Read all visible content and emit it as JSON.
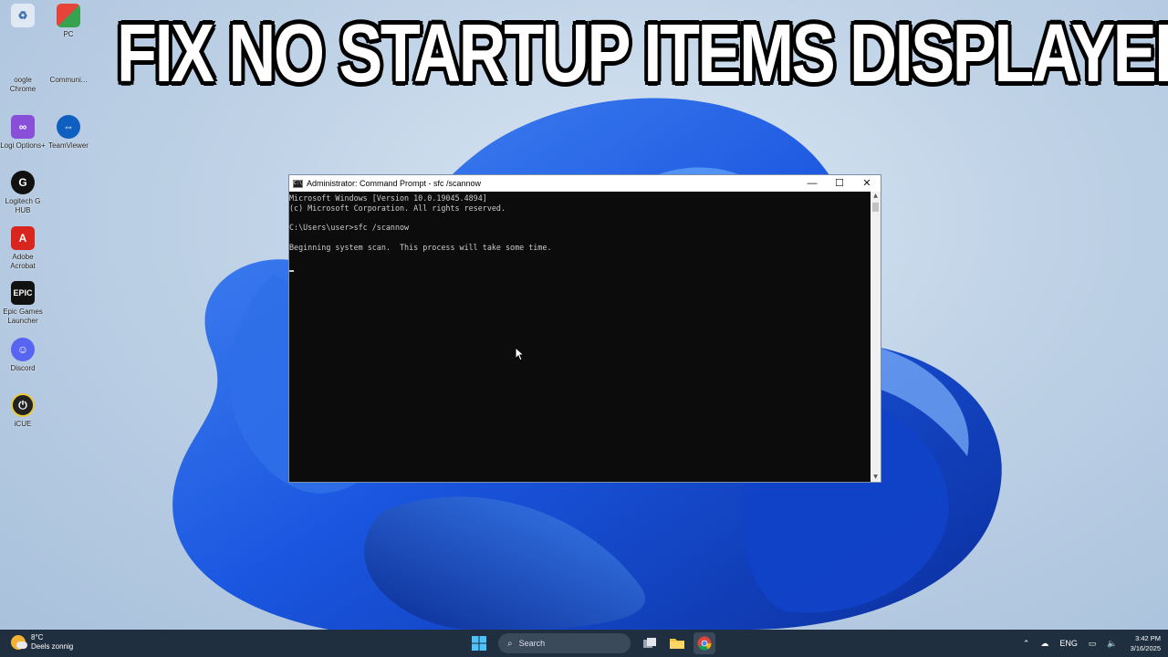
{
  "headline": "FIX NO STARTUP ITEMS DISPLAYED",
  "desktop_icons": [
    {
      "label": "",
      "icon": "recycle-bin-icon"
    },
    {
      "label": "PC",
      "icon": "pc-icon"
    },
    {
      "label": "oogle Chrome",
      "icon": "chrome-icon"
    },
    {
      "label": "Communi...",
      "icon": "community-app-icon"
    },
    {
      "label": "Logi Options+",
      "icon": "logi-options-icon"
    },
    {
      "label": "TeamViewer",
      "icon": "teamviewer-icon"
    },
    {
      "label": "Logitech G HUB",
      "icon": "logitech-g-hub-icon"
    },
    {
      "label": "Adobe Acrobat",
      "icon": "adobe-acrobat-icon"
    },
    {
      "label": "Epic Games Launcher",
      "icon": "epic-games-icon"
    },
    {
      "label": "Discord",
      "icon": "discord-icon"
    },
    {
      "label": "iCUE",
      "icon": "icue-icon"
    }
  ],
  "cmd_window": {
    "title": "Administrator: Command Prompt - sfc  /scannow",
    "lines": [
      "Microsoft Windows [Version 10.0.19045.4894]",
      "(c) Microsoft Corporation. All rights reserved.",
      "",
      "C:\\Users\\user>sfc /scannow",
      "",
      "Beginning system scan.  This process will take some time."
    ],
    "minimize": "—",
    "maximize": "☐",
    "close": "✕"
  },
  "taskbar": {
    "weather_temp": "8°C",
    "weather_desc": "Deels zonnig",
    "search_placeholder": "Search",
    "language": "ENG",
    "time": "3:42 PM",
    "date": "3/16/2025"
  },
  "colors": {
    "console_bg": "#0c0c0c",
    "console_text": "#cccccc",
    "taskbar_bg": "#1f2f3f",
    "bloom_blue": "#1a56e0"
  }
}
